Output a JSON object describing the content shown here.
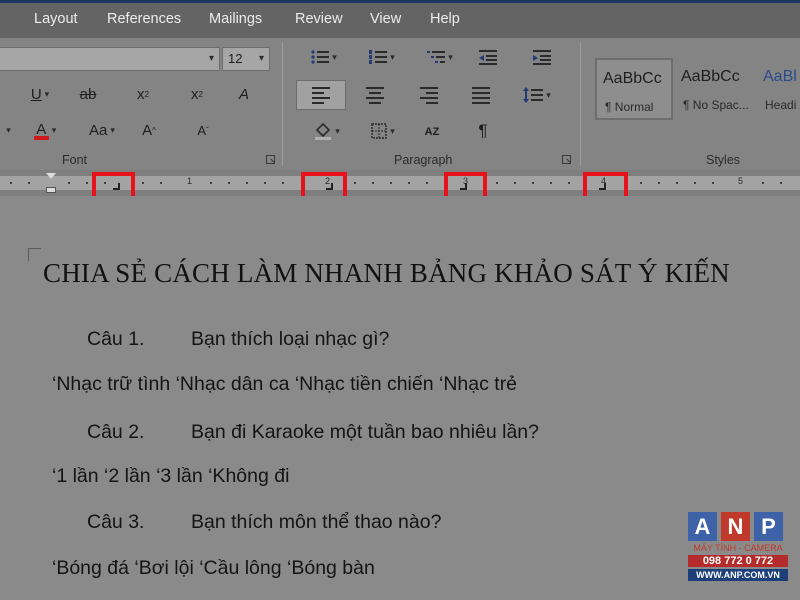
{
  "menu": {
    "items": [
      "Layout",
      "References",
      "Mailings",
      "Review",
      "View",
      "Help"
    ]
  },
  "ribbon": {
    "font_group": {
      "label": "Font",
      "font_size": "12",
      "underline": "U",
      "strikethrough": "ab",
      "subscript_base": "x",
      "subscript_mark": "2",
      "superscript_base": "x",
      "superscript_mark": "2",
      "clear_format": "A",
      "font_color": "A",
      "change_case": "Aa",
      "grow_font": "A",
      "shrink_font": "A",
      "font_color_swatch": "#d01818"
    },
    "paragraph_group": {
      "label": "Paragraph",
      "sort": "AZ",
      "pilcrow": "¶"
    },
    "styles_group": {
      "label": "Styles",
      "items": [
        {
          "preview": "AaBbCc",
          "name": "¶ Normal"
        },
        {
          "preview": "AaBbCc",
          "name": "¶ No Spac..."
        },
        {
          "preview": "AaBl",
          "name": "Headi"
        }
      ]
    }
  },
  "ruler": {
    "numbers": [
      "1",
      "2",
      "3",
      "4",
      "5"
    ]
  },
  "document": {
    "title": "CHIA SẺ CÁCH LÀM NHANH BẢNG KHẢO SÁT Ý KIẾN",
    "questions": [
      {
        "number": "Câu 1.",
        "text": "Bạn thích loại nhạc gì?",
        "options": "‘Nhạc trữ tình ‘Nhạc dân ca ‘Nhạc tiền chiến ‘Nhạc trẻ"
      },
      {
        "number": "Câu 2.",
        "text": "Bạn đi Karaoke một tuần bao nhiêu lần?",
        "options": "‘1 lần ‘2 lần ‘3 lần ‘Không đi"
      },
      {
        "number": "Câu 3.",
        "text": "Bạn thích môn thể thao nào?",
        "options": "‘Bóng đá ‘Bơi lội ‘Cầu lông ‘Bóng bàn"
      }
    ]
  },
  "logo": {
    "letters": [
      "A",
      "N",
      "P"
    ],
    "tagline": "MÁY TÍNH - CAMERA",
    "phone": "098 772 0 772",
    "website": "WWW.ANP.COM.VN",
    "colors": {
      "a": "#3e62a8",
      "n": "#c0392b",
      "p": "#3e62a8",
      "tagline": "#c0392b"
    }
  }
}
